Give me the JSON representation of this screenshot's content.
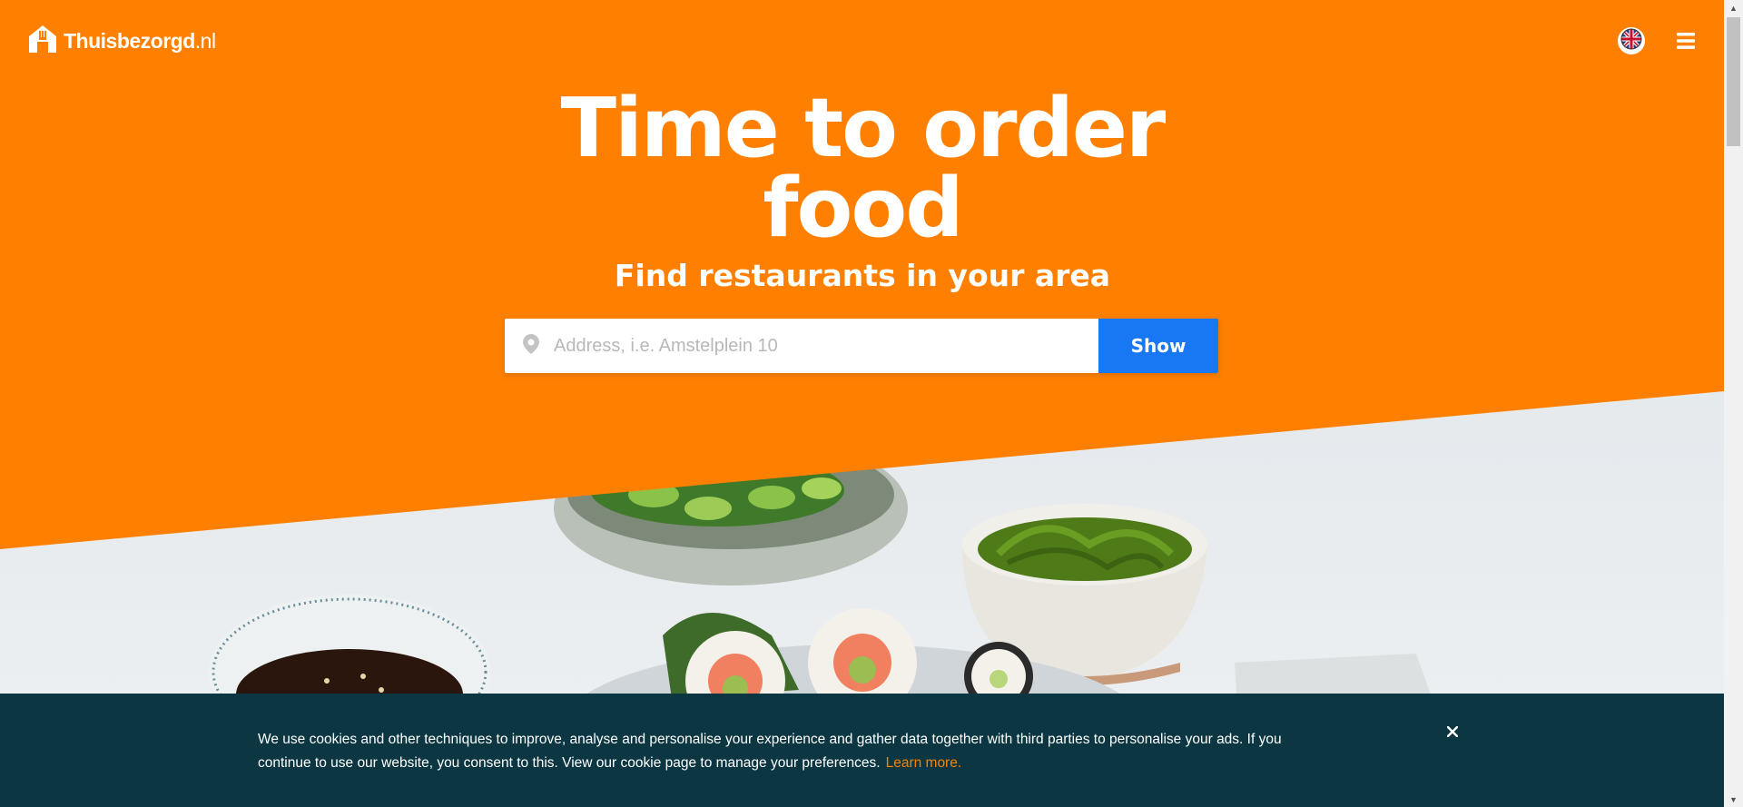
{
  "header": {
    "logo_brand": "Thuisbezorgd",
    "logo_tld": ".nl",
    "language_icon": "uk-flag-icon",
    "menu_icon": "hamburger-menu-icon"
  },
  "hero": {
    "headline_line1": "Time to order",
    "headline_line2": "food",
    "subheadline": "Find restaurants in your area",
    "background_color": "#ff8000"
  },
  "search": {
    "placeholder": "Address, i.e. Amstelplein 10",
    "value": "",
    "location_icon": "location-pin-icon",
    "button_label": "Show",
    "button_color": "#1877f2"
  },
  "cookie_banner": {
    "text": "We use cookies and other techniques to improve, analyse and personalise your experience and gather data together with third parties to personalise your ads. If you continue to use our website, you consent to this. View our cookie page to manage your preferences.",
    "link_label": "Learn more.",
    "close_icon": "close-icon",
    "background_color": "#0b3642",
    "link_color": "#ff8000"
  }
}
